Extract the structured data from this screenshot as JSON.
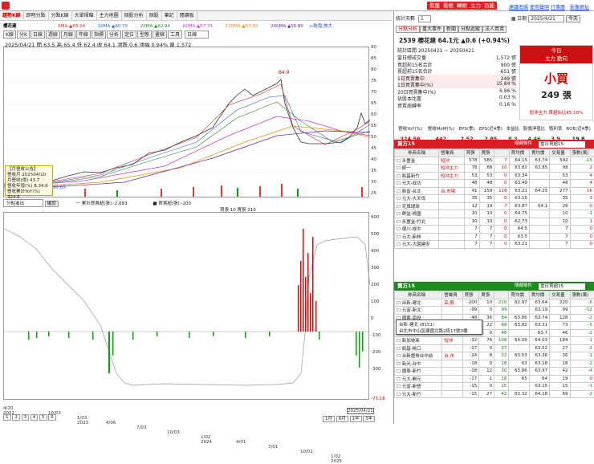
{
  "top": {
    "buttons": [
      "看盤",
      "看帳",
      "轉帳",
      "主力",
      "功能"
    ],
    "links": [
      "建議密碼",
      "使用聲明",
      "行事曆",
      "影像網址"
    ]
  },
  "menu": [
    "趨勢K線",
    "即時分點",
    "分點K線",
    "大單掃瞄",
    "主力地圖",
    "個股分析",
    "個股",
    "筆記",
    "閱讀板"
  ],
  "stock": {
    "name": "櫻花建",
    "label": "櫻花建",
    "ma": [
      {
        "t": "5MA ▲63.24",
        "c": "#cc2222"
      },
      {
        "t": "10MA ▲60.70",
        "c": "#2266cc"
      },
      {
        "t": "20MA ▲62.94",
        "c": "#228822"
      },
      {
        "t": "60MA ▲57.74",
        "c": "#cc33cc"
      },
      {
        "t": "120MA ▲53.60",
        "c": "#ee8800"
      },
      {
        "t": "200MA ▲56.80",
        "c": "#6622aa"
      }
    ],
    "toolbar": [
      "K線",
      "分K",
      "日線",
      "週線",
      "月線",
      "年線",
      "指標",
      "分析",
      "定位",
      "型態",
      "畫線",
      "工具"
    ],
    "select": "日線",
    "info": "2025/04/21 開 63.5 高 65.4 低 62.4 收 64.1 漲跌 0.6 漲幅 0.94% 量 1,572",
    "peak": "84.9",
    "min_label": "30.65",
    "scroll_note": "←拖曳,放大"
  },
  "yaxis": [
    "90",
    "85",
    "80",
    "75",
    "70",
    "65",
    "60",
    "55",
    "50",
    "45",
    "40",
    "35",
    "30",
    "25"
  ],
  "xaxis": [
    "4/20\n2022",
    "10/03",
    "1/03\n2023",
    "4/06",
    "7/03",
    "10/03",
    "1/02\n2024",
    "4/01",
    "7/01",
    "10/01",
    "1/02\n2025",
    "2025/04/21"
  ],
  "tooltip": {
    "lines": [
      "【月營收公告】",
      "營收月 202504/10",
      "月營收(億) 43.7",
      "營收年增(%) 8.34.6",
      "營收累計YoY(%) 324.6"
    ]
  },
  "sub": {
    "selector": "分點進出",
    "button": "確認",
    "legend1": "一 累計買賣超(張):-2,683",
    "legend2": "■ 買賣超(張):-200",
    "legend3": "買張 10 賣張 210",
    "y": [
      "600",
      "500",
      "400",
      "300",
      "200",
      "100",
      "0",
      "-100",
      "-200",
      "-300"
    ],
    "last": "-73.18"
  },
  "bottom": {
    "pages": [
      "1",
      "2",
      "3",
      "4",
      "5",
      "6"
    ],
    "ranges": [
      "1月",
      "6月",
      "1年",
      "3年"
    ]
  },
  "right": {
    "days_label": "統計天數",
    "days": "1",
    "date_label": "日期",
    "date": "2025/4/21",
    "today_btn": "今天",
    "tabs": [
      "分點分析",
      "重大事件",
      "新聞",
      "分點追蹤",
      "法人買賣"
    ],
    "title": "2539 櫻花建 64.1元 ▲0.6 (+0.94%)",
    "period_label": "統計區間",
    "period": "20250421 ~ 20250421",
    "stats": [
      {
        "k": "當日總成交量",
        "v": "1,572 張"
      },
      {
        "k": "買超前15名合計",
        "v": "900 張"
      },
      {
        "k": "賣超前15名合計",
        "v": "-651 張"
      },
      {
        "k": "1日買賣集中",
        "v": "249 張"
      },
      {
        "k": "1日買賣集中(%)",
        "v": "15.84 %"
      },
      {
        "k": "20日買賣集中(%)",
        "v": "6.86 %"
      },
      {
        "k": "佔股本比重",
        "v": "0.03 %"
      },
      {
        "k": "買賣周轉率",
        "v": "0.16 %"
      }
    ],
    "today": {
      "head": "今日",
      "sub": "主力 動向",
      "big": "小買",
      "zhang": "249 張",
      "footer": "短沖主力 買超佔比45.10%"
    },
    "metrics_h": [
      "營收YoY(%)",
      "營收MoM(%)",
      "EPS(季)",
      "EPS(近4季)",
      "本益比",
      "股價淨值比",
      "殖利率",
      "ROE(近4季)"
    ],
    "metrics_v": [
      "324.56",
      "442",
      "2.52",
      "2.85",
      "8.3",
      "4.46",
      "3.9",
      "19.8"
    ],
    "buy_title": "買方15",
    "sell_title": "賣方15",
    "filter_label": "隱藏條件",
    "filter": "當日買超15",
    "cols": [
      "券商名稱",
      "營業員",
      "買張",
      "賣張",
      "買均價",
      "賣均價",
      "交易量",
      "張數(萬)"
    ],
    "buy": [
      [
        "永豐金",
        "短沖",
        "578",
        "585",
        "7",
        "64.15",
        "63.74",
        "592",
        "-15"
      ],
      [
        "統一",
        "短沖主力",
        "78",
        "88",
        "10",
        "63.82",
        "63.85",
        "98",
        "2"
      ],
      [
        "凱基新竹",
        "短沖主力",
        "53",
        "53",
        "0",
        "63.34",
        "",
        "53",
        "4"
      ],
      [
        "元大-成功",
        "",
        "48",
        "48",
        "0",
        "63.49",
        "",
        "48",
        "4"
      ],
      [
        "新富-台北",
        "台,市場",
        "41",
        "159",
        "118",
        "63.21",
        "64.25",
        "277",
        "16"
      ],
      [
        "元大-大天母",
        "",
        "35",
        "35",
        "0",
        "63.15",
        "",
        "35",
        "3"
      ],
      [
        "花旗環球",
        "",
        "12",
        "19",
        "7",
        "63.87",
        "64.1",
        "26",
        "0"
      ],
      [
        "群益-桃園",
        "",
        "10",
        "10",
        "0",
        "64.75",
        "",
        "10",
        "-1"
      ],
      [
        "永豐金-竹北",
        "",
        "10",
        "10",
        "0",
        "62.73",
        "",
        "10",
        "1"
      ],
      [
        "德川-成中",
        "",
        "7",
        "7",
        "0",
        "64.5",
        "",
        "7",
        "0"
      ],
      [
        "元大-新林",
        "",
        "7",
        "7",
        "0",
        "63.5",
        "",
        "7",
        "0"
      ],
      [
        "元大-大園建安",
        "",
        "7",
        "7",
        "0",
        "63.21",
        "",
        "7",
        "0"
      ]
    ],
    "sell": [
      [
        "台新-建北",
        "高,股",
        "-200",
        "10",
        "210",
        "62.97",
        "63.64",
        "220",
        "-6"
      ],
      [
        "元富-新北",
        "",
        "-99",
        "0",
        "99",
        "",
        "63.19",
        "99",
        "-12"
      ],
      [
        "國票-南投",
        "",
        "-48",
        "36",
        "84",
        "63.86",
        "63.74",
        "128",
        "-2"
      ],
      [
        "富邦",
        "",
        "-46",
        "22",
        "68",
        "63.82",
        "63.31",
        "73",
        "-5"
      ],
      [
        "永豐金-彰化",
        "",
        "-46",
        "0",
        "46",
        "",
        "63.7",
        "46",
        "-2"
      ],
      [
        "新加坡商",
        "短沖",
        "-32",
        "76",
        "108",
        "64.09",
        "64.03",
        "184",
        "-1"
      ],
      [
        "凱基-桃口",
        "",
        "-27",
        "0",
        "27",
        "",
        "63.52",
        "27",
        "-2"
      ],
      [
        "台新證券台中前",
        "台,市",
        "-24",
        "8",
        "32",
        "63.53",
        "63.36",
        "36",
        "-1"
      ],
      [
        "新光-台中",
        "",
        "-18",
        "0",
        "18",
        "63",
        "63.18",
        "18",
        "-2"
      ],
      [
        "國泰-新竹",
        "",
        "-18",
        "12",
        "30",
        "63.86",
        "63.97",
        "42",
        "-4"
      ],
      [
        "元大-開元",
        "",
        "-17",
        "1",
        "18",
        "65",
        "64",
        "19",
        "0"
      ],
      [
        "元富-新營",
        "",
        "-15",
        "0",
        "15",
        "",
        "63.15",
        "15",
        "-1"
      ],
      [
        "元大-新竹",
        "",
        "-15",
        "27",
        "42",
        "63.32",
        "64.18",
        "69",
        "-2"
      ]
    ],
    "popup": {
      "line1": "台新-建北 (8151)",
      "line2": "台北市中山區建國北路2段17號3樓"
    }
  }
}
